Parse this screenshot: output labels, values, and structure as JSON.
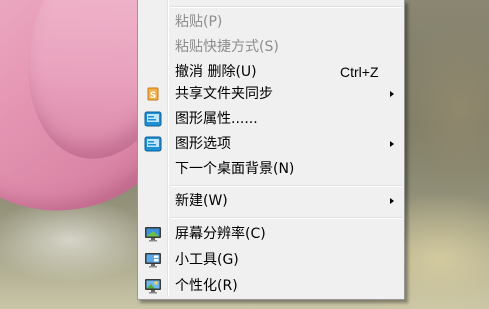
{
  "context_menu": {
    "items": [
      {
        "label": "粘贴(P)",
        "enabled": false
      },
      {
        "label": "粘贴快捷方式(S)",
        "enabled": false
      },
      {
        "label": "撤消 删除(U)",
        "shortcut": "Ctrl+Z",
        "enabled": true
      },
      {
        "label": "共享文件夹同步",
        "submenu": true,
        "icon": "sync-share-icon",
        "enabled": true
      },
      {
        "label": "图形属性......",
        "icon": "graphics-properties-icon",
        "enabled": true
      },
      {
        "label": "图形选项",
        "submenu": true,
        "icon": "graphics-options-icon",
        "enabled": true
      },
      {
        "label": "下一个桌面背景(N)",
        "enabled": true
      },
      {
        "label": "新建(W)",
        "submenu": true,
        "enabled": true
      },
      {
        "label": "屏幕分辨率(C)",
        "icon": "screen-resolution-icon",
        "enabled": true
      },
      {
        "label": "小工具(G)",
        "icon": "gadgets-icon",
        "enabled": true
      },
      {
        "label": "个性化(R)",
        "icon": "personalize-icon",
        "enabled": true
      }
    ]
  },
  "colors": {
    "menu_bg": "#f0f0f0",
    "disabled_text": "#8d8d8d",
    "petal": "#e596b3"
  }
}
